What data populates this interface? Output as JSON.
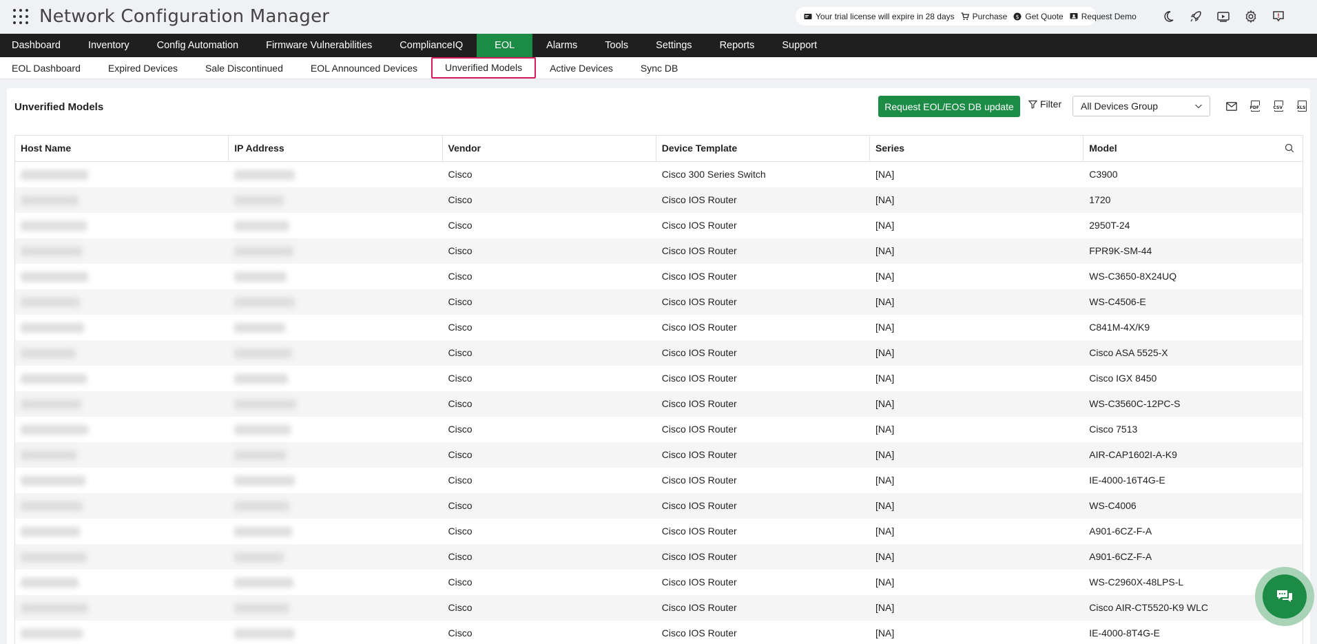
{
  "header": {
    "app_title": "Network Configuration Manager",
    "trial_text": "Your trial license will expire in 28 days",
    "purchase": "Purchase",
    "get_quote": "Get Quote",
    "request_demo": "Request Demo"
  },
  "main_nav": [
    {
      "label": "Dashboard",
      "active": false
    },
    {
      "label": "Inventory",
      "active": false
    },
    {
      "label": "Config Automation",
      "active": false
    },
    {
      "label": "Firmware Vulnerabilities",
      "active": false
    },
    {
      "label": "ComplianceIQ",
      "active": false
    },
    {
      "label": "EOL",
      "active": true
    },
    {
      "label": "Alarms",
      "active": false
    },
    {
      "label": "Tools",
      "active": false
    },
    {
      "label": "Settings",
      "active": false
    },
    {
      "label": "Reports",
      "active": false
    },
    {
      "label": "Support",
      "active": false
    }
  ],
  "sub_nav": [
    {
      "label": "EOL Dashboard",
      "active": false
    },
    {
      "label": "Expired Devices",
      "active": false
    },
    {
      "label": "Sale Discontinued",
      "active": false
    },
    {
      "label": "EOL Announced Devices",
      "active": false
    },
    {
      "label": "Unverified Models",
      "active": true
    },
    {
      "label": "Active Devices",
      "active": false
    },
    {
      "label": "Sync DB",
      "active": false
    }
  ],
  "panel": {
    "title": "Unverified Models",
    "request_button": "Request EOL/EOS DB update",
    "filter_label": "Filter",
    "group_select": "All Devices Group"
  },
  "colors": {
    "accent": "#1c8b46",
    "nav_bg": "#1f1f1f",
    "highlight_border": "#d6195d"
  },
  "table": {
    "columns": [
      "Host Name",
      "IP Address",
      "Vendor",
      "Device Template",
      "Series",
      "Model"
    ],
    "rows": [
      {
        "vendor": "Cisco",
        "template": "Cisco 300 Series Switch",
        "series": "[NA]",
        "model": "C3900"
      },
      {
        "vendor": "Cisco",
        "template": "Cisco IOS Router",
        "series": "[NA]",
        "model": "1720"
      },
      {
        "vendor": "Cisco",
        "template": "Cisco IOS Router",
        "series": "[NA]",
        "model": "2950T-24"
      },
      {
        "vendor": "Cisco",
        "template": "Cisco IOS Router",
        "series": "[NA]",
        "model": "FPR9K-SM-44"
      },
      {
        "vendor": "Cisco",
        "template": "Cisco IOS Router",
        "series": "[NA]",
        "model": "WS-C3650-8X24UQ"
      },
      {
        "vendor": "Cisco",
        "template": "Cisco IOS Router",
        "series": "[NA]",
        "model": "WS-C4506-E"
      },
      {
        "vendor": "Cisco",
        "template": "Cisco IOS Router",
        "series": "[NA]",
        "model": "C841M-4X/K9"
      },
      {
        "vendor": "Cisco",
        "template": "Cisco IOS Router",
        "series": "[NA]",
        "model": "Cisco ASA 5525-X"
      },
      {
        "vendor": "Cisco",
        "template": "Cisco IOS Router",
        "series": "[NA]",
        "model": "Cisco IGX 8450"
      },
      {
        "vendor": "Cisco",
        "template": "Cisco IOS Router",
        "series": "[NA]",
        "model": "WS-C3560C-12PC-S"
      },
      {
        "vendor": "Cisco",
        "template": "Cisco IOS Router",
        "series": "[NA]",
        "model": "Cisco 7513"
      },
      {
        "vendor": "Cisco",
        "template": "Cisco IOS Router",
        "series": "[NA]",
        "model": "AIR-CAP1602I-A-K9"
      },
      {
        "vendor": "Cisco",
        "template": "Cisco IOS Router",
        "series": "[NA]",
        "model": "IE-4000-16T4G-E"
      },
      {
        "vendor": "Cisco",
        "template": "Cisco IOS Router",
        "series": "[NA]",
        "model": "WS-C4006"
      },
      {
        "vendor": "Cisco",
        "template": "Cisco IOS Router",
        "series": "[NA]",
        "model": "A901-6CZ-F-A"
      },
      {
        "vendor": "Cisco",
        "template": "Cisco IOS Router",
        "series": "[NA]",
        "model": "A901-6CZ-F-A"
      },
      {
        "vendor": "Cisco",
        "template": "Cisco IOS Router",
        "series": "[NA]",
        "model": "WS-C2960X-48LPS-L"
      },
      {
        "vendor": "Cisco",
        "template": "Cisco IOS Router",
        "series": "[NA]",
        "model": "Cisco AIR-CT5520-K9 WLC"
      },
      {
        "vendor": "Cisco",
        "template": "Cisco IOS Router",
        "series": "[NA]",
        "model": "IE-4000-8T4G-E"
      }
    ]
  },
  "icons": {
    "apps": "apps-grid-icon",
    "dark_mode": "moon-icon",
    "whats_new": "rocket-icon",
    "video": "video-icon",
    "settings": "gear-icon",
    "alerts": "alert-icon",
    "email": "mail-icon",
    "chat": "chat-icon"
  }
}
